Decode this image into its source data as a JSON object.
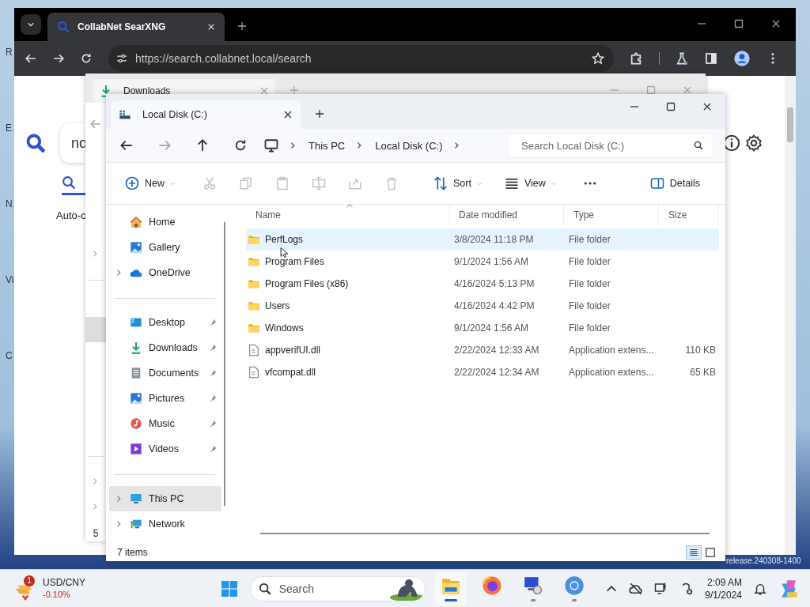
{
  "desktop": {
    "edge_labels": [
      "R",
      "E",
      "N",
      "Vi",
      "C"
    ],
    "build_text": "release.240308-1400"
  },
  "browser": {
    "tab_title": "CollabNet SearXNG",
    "url": "https://search.collabnet.local/search",
    "search_query": "no",
    "autocomplete_label": "Auto-c"
  },
  "back_window": {
    "tab_title": "Downloads",
    "status": "5"
  },
  "explorer": {
    "tab_title": "Local Disk (C:)",
    "breadcrumb": [
      "This PC",
      "Local Disk (C:)"
    ],
    "search_placeholder": "Search Local Disk (C:)",
    "toolbar": [
      {
        "kind": "new",
        "label": "New",
        "disabled": false
      },
      {
        "kind": "cut",
        "disabled": true
      },
      {
        "kind": "copy",
        "disabled": true
      },
      {
        "kind": "paste",
        "disabled": true
      },
      {
        "kind": "rename",
        "disabled": true
      },
      {
        "kind": "share",
        "disabled": true
      },
      {
        "kind": "delete",
        "disabled": true
      },
      {
        "kind": "sort",
        "label": "Sort",
        "disabled": false
      },
      {
        "kind": "view",
        "label": "View",
        "disabled": false
      },
      {
        "kind": "more",
        "disabled": false
      }
    ],
    "details_label": "Details",
    "sidebar_groups": [
      [
        {
          "label": "Home",
          "kind": "home",
          "expandable": false,
          "pinned": false,
          "selected": false
        },
        {
          "label": "Gallery",
          "kind": "gallery",
          "expandable": false,
          "pinned": false,
          "selected": false
        },
        {
          "label": "OneDrive",
          "kind": "cloud",
          "expandable": true,
          "pinned": false,
          "selected": false
        }
      ],
      [
        {
          "label": "Desktop",
          "kind": "desktop",
          "expandable": false,
          "pinned": true,
          "selected": false
        },
        {
          "label": "Downloads",
          "kind": "download",
          "expandable": false,
          "pinned": true,
          "selected": false
        },
        {
          "label": "Documents",
          "kind": "document",
          "expandable": false,
          "pinned": true,
          "selected": false
        },
        {
          "label": "Pictures",
          "kind": "pictures",
          "expandable": false,
          "pinned": true,
          "selected": false
        },
        {
          "label": "Music",
          "kind": "music",
          "expandable": false,
          "pinned": true,
          "selected": false
        },
        {
          "label": "Videos",
          "kind": "videos",
          "expandable": false,
          "pinned": true,
          "selected": false
        }
      ],
      [
        {
          "label": "This PC",
          "kind": "pc",
          "expandable": true,
          "pinned": false,
          "selected": true
        },
        {
          "label": "Network",
          "kind": "network",
          "expandable": true,
          "pinned": false,
          "selected": false
        }
      ]
    ],
    "columns": [
      {
        "label": "Name",
        "sorted": true
      },
      {
        "label": "Date modified",
        "sorted": false
      },
      {
        "label": "Type",
        "sorted": false
      },
      {
        "label": "Size",
        "sorted": false
      }
    ],
    "rows": [
      {
        "kind": "folder",
        "name": "PerfLogs",
        "date": "3/8/2024 11:18 PM",
        "type": "File folder",
        "selected": true
      },
      {
        "kind": "folder",
        "name": "Program Files",
        "date": "9/1/2024 1:56 AM",
        "type": "File folder",
        "selected": false
      },
      {
        "kind": "folder",
        "name": "Program Files (x86)",
        "date": "4/16/2024 5:13 PM",
        "type": "File folder",
        "selected": false
      },
      {
        "kind": "folder",
        "name": "Users",
        "date": "4/16/2024 4:42 PM",
        "type": "File folder",
        "selected": false
      },
      {
        "kind": "folder",
        "name": "Windows",
        "date": "9/1/2024 1:56 AM",
        "type": "File folder",
        "selected": false
      },
      {
        "kind": "file",
        "name": "appverifUI.dll",
        "date": "2/22/2024 12:33 AM",
        "type": "Application extens...",
        "size": "110 KB",
        "selected": false
      },
      {
        "kind": "file",
        "name": "vfcompat.dll",
        "date": "2/22/2024 12:34 AM",
        "type": "Application extens...",
        "size": "65 KB",
        "selected": false
      }
    ],
    "status": "7 items",
    "view_modes": [
      {
        "kind": "details",
        "selected": true
      },
      {
        "kind": "tiles",
        "selected": false
      }
    ]
  },
  "taskbar": {
    "widget": {
      "title": "USD/CNY",
      "change": "-0.10%",
      "badge": "1"
    },
    "search_placeholder": "Search",
    "apps": [
      {
        "kind": "explorer",
        "running": true,
        "active": true
      },
      {
        "kind": "firefox",
        "running": false,
        "active": false
      },
      {
        "kind": "remote",
        "running": true,
        "active": false
      },
      {
        "kind": "chrome",
        "running": true,
        "active": false
      }
    ],
    "time": "2:09 AM",
    "date": "9/1/2024"
  }
}
